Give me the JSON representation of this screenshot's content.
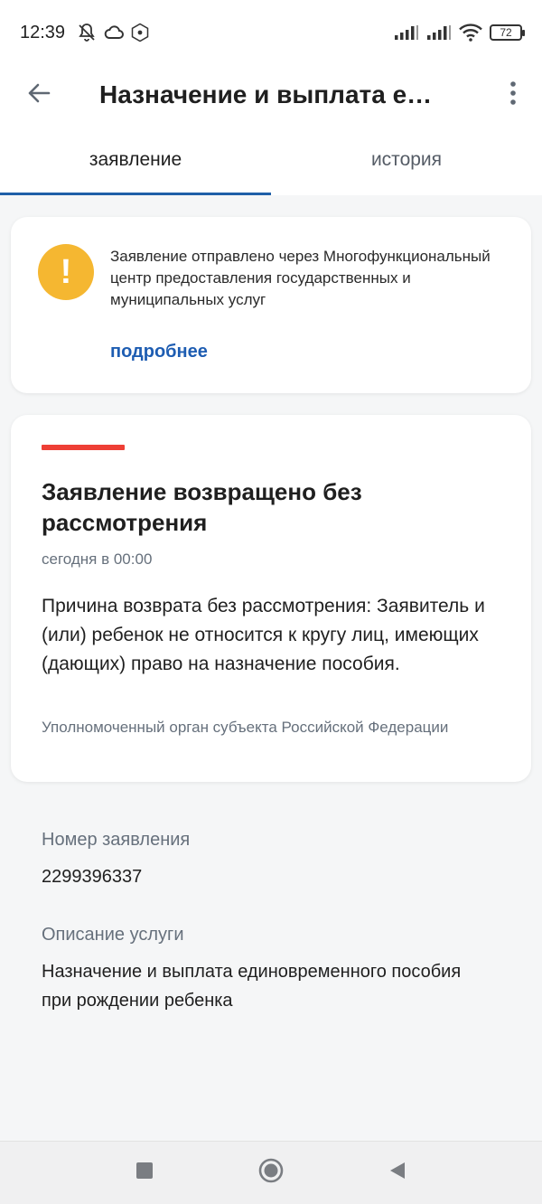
{
  "status_bar": {
    "time": "12:39",
    "battery": "72",
    "icons": [
      "notifications-muted-icon",
      "cloud-icon",
      "app-badge-icon",
      "signal-icon",
      "signal-icon",
      "wifi-icon",
      "battery-icon"
    ]
  },
  "app_bar": {
    "title": "Назначение и выплата е…",
    "back_icon": "arrow-back-icon",
    "menu_icon": "more-vert-icon"
  },
  "tabs": [
    {
      "label": "заявление",
      "active": true
    },
    {
      "label": "история",
      "active": false
    }
  ],
  "info_card": {
    "icon": "warning-icon",
    "icon_color": "#f5b731",
    "text": "Заявление отправлено через Многофункциональный центр предоставления государственных и муниципальных услуг",
    "link": "подробнее"
  },
  "status_card": {
    "accent_color": "#ee3f35",
    "title": "Заявление возвращено без рассмотрения",
    "date": "сегодня в 00:00",
    "reason": "Причина возврата без рассмотрения: Заявитель и (или) ребенок не относится к кругу лиц, имеющих (дающих) право на назначение пособия.",
    "organization": "Уполномоченный орган субъекта Российской Федерации"
  },
  "details": {
    "number_label": "Номер заявления",
    "number_value": "2299396337",
    "description_label": "Описание услуги",
    "description_value": "Назначение и выплата единовременного пособия при рождении ребенка"
  },
  "nav_bar": {
    "buttons": [
      "recents-icon",
      "home-icon",
      "back-icon"
    ]
  },
  "colors": {
    "accent_blue": "#1f5fa8",
    "link_blue": "#1e5db2",
    "muted_text": "#66707c"
  }
}
